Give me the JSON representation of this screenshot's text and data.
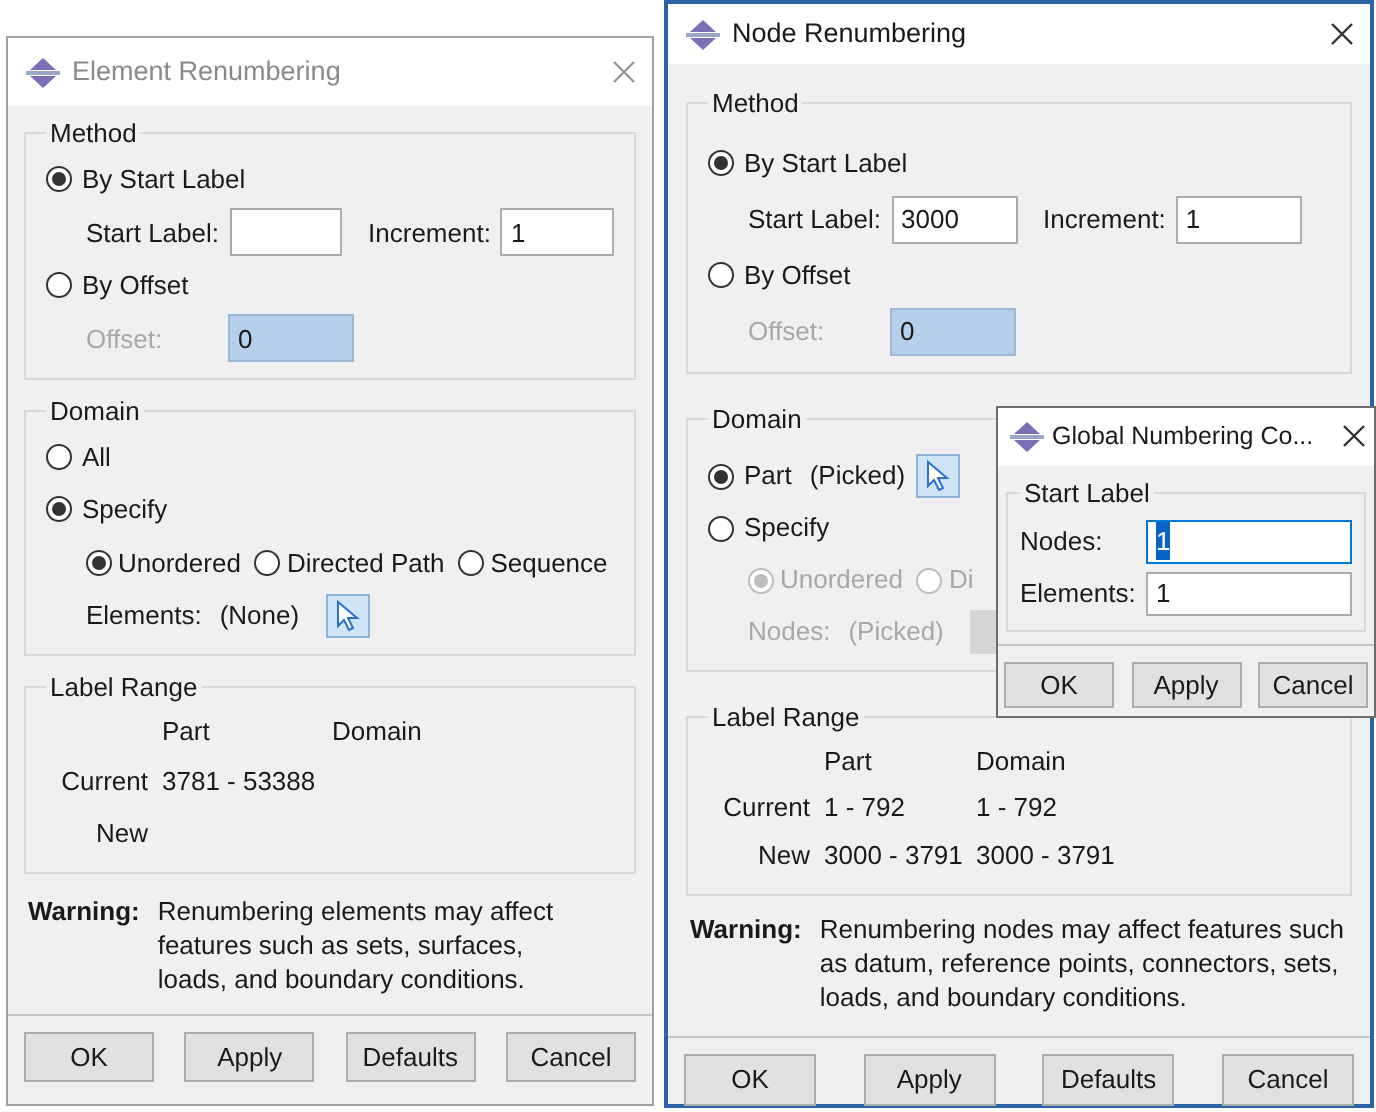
{
  "element_dialog": {
    "kind": "element",
    "title": "Element Renumbering",
    "active": false,
    "method": {
      "title": "Method",
      "options": [
        {
          "label": "By Start Label",
          "selected": true
        },
        {
          "label": "By Offset",
          "selected": false
        }
      ],
      "start_label": {
        "label": "Start Label:"
      },
      "increment": {
        "label": "Increment:",
        "value": "1"
      },
      "offset": {
        "label": "Offset:",
        "value": "0",
        "disabled": true
      }
    },
    "domain": {
      "title": "Domain",
      "options": [
        {
          "label": "All",
          "selected": false
        },
        {
          "label": "Specify",
          "selected": true
        }
      ],
      "sub_options": {
        "disabled": false,
        "items": [
          {
            "label": "Unordered",
            "selected": true
          },
          {
            "label": "Directed Path",
            "selected": false
          },
          {
            "label": "Sequence",
            "selected": false
          }
        ]
      },
      "pick": {
        "label": "Elements:",
        "value": "(None)",
        "disabled": false
      }
    },
    "label_range": {
      "title": "Label Range",
      "columns": [
        "Part",
        "Domain"
      ],
      "rows": [
        {
          "label": "Current",
          "values": [
            "3781 - 53388"
          ]
        },
        {
          "label": "New",
          "values": []
        }
      ]
    },
    "warning": {
      "label": "Warning:",
      "text": "Renumbering elements may affect features such as sets, surfaces, loads, and boundary conditions."
    },
    "buttons": [
      "OK",
      "Apply",
      "Defaults",
      "Cancel"
    ]
  },
  "node_dialog": {
    "kind": "node",
    "title": "Node Renumbering",
    "active": true,
    "method": {
      "title": "Method",
      "options": [
        {
          "label": "By Start Label",
          "selected": true
        },
        {
          "label": "By Offset",
          "selected": false
        }
      ],
      "start_label": {
        "label": "Start Label:",
        "value": "3000"
      },
      "increment": {
        "label": "Increment:",
        "value": "1"
      },
      "offset": {
        "label": "Offset:",
        "value": "0",
        "disabled": true
      }
    },
    "domain": {
      "title": "Domain",
      "options": [
        {
          "label": "Part",
          "selected": true,
          "note": "(Picked)",
          "has_picker": true
        },
        {
          "label": "Specify",
          "selected": false
        }
      ],
      "sub_options": {
        "disabled": true,
        "items": [
          {
            "label": "Unordered",
            "selected": true
          },
          {
            "label": "Di",
            "selected": false
          }
        ]
      },
      "pick": {
        "label": "Nodes:",
        "value": "(Picked)",
        "disabled": true
      }
    },
    "label_range": {
      "title": "Label Range",
      "columns": [
        "Part",
        "Domain"
      ],
      "rows": [
        {
          "label": "Current",
          "values": [
            "1 - 792",
            "1 - 792"
          ]
        },
        {
          "label": "New",
          "values": [
            "3000 - 3791",
            "3000 - 3791"
          ]
        }
      ]
    },
    "warning": {
      "label": "Warning:",
      "text": "Renumbering nodes may affect features such as datum, reference points, connectors, sets, loads, and boundary conditions."
    },
    "buttons": [
      "OK",
      "Apply",
      "Defaults",
      "Cancel"
    ]
  },
  "global_dialog": {
    "title": "Global Numbering Co...",
    "active": true,
    "group": {
      "title": "Start Label",
      "fields": [
        {
          "label": "Nodes:",
          "value": "1",
          "focused": true
        },
        {
          "label": "Elements:",
          "value": "1",
          "focused": false
        }
      ]
    },
    "buttons": [
      "OK",
      "Apply",
      "Cancel"
    ]
  }
}
